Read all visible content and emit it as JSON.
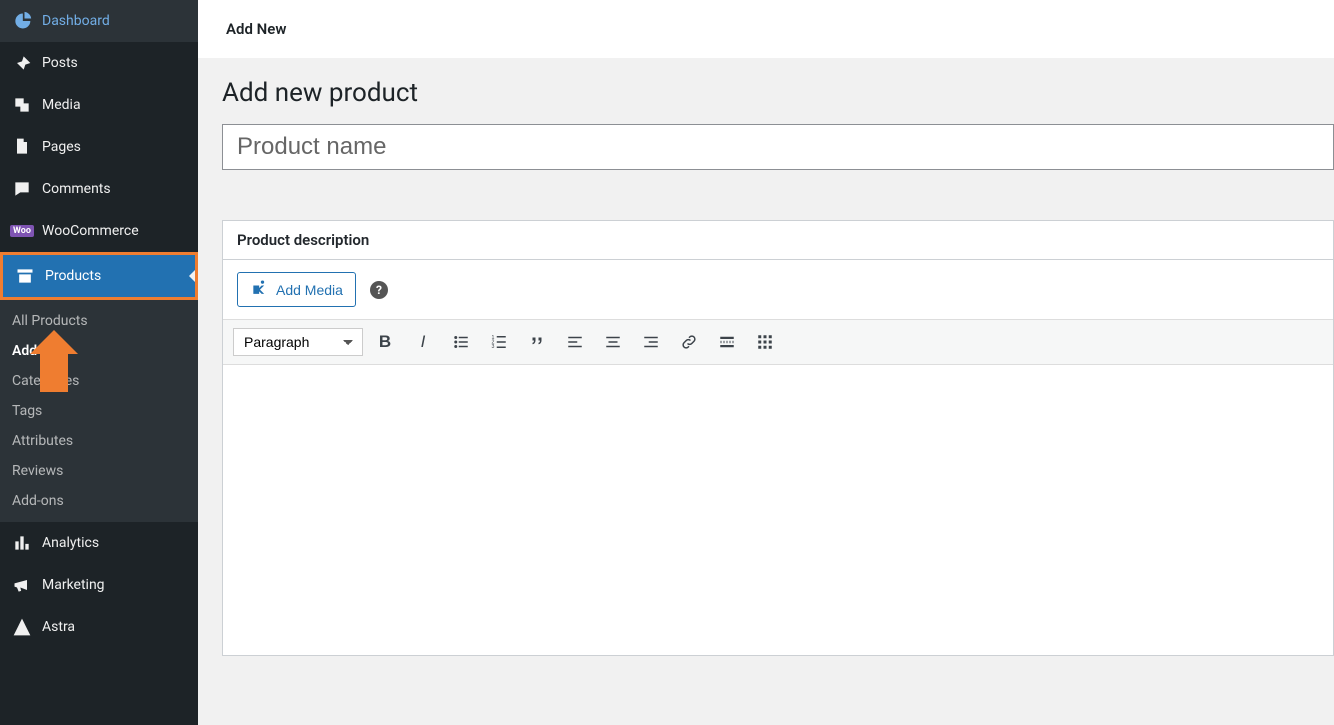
{
  "sidebar": {
    "items": [
      {
        "label": "Dashboard"
      },
      {
        "label": "Posts"
      },
      {
        "label": "Media"
      },
      {
        "label": "Pages"
      },
      {
        "label": "Comments"
      },
      {
        "label": "WooCommerce"
      },
      {
        "label": "Products"
      },
      {
        "label": "Analytics"
      },
      {
        "label": "Marketing"
      },
      {
        "label": "Astra"
      }
    ],
    "submenu": [
      {
        "label": "All Products"
      },
      {
        "label": "Add New"
      },
      {
        "label": "Categories"
      },
      {
        "label": "Tags"
      },
      {
        "label": "Attributes"
      },
      {
        "label": "Reviews"
      },
      {
        "label": "Add-ons"
      }
    ]
  },
  "header": {
    "breadcrumb": "Add New"
  },
  "page": {
    "title": "Add new product",
    "name_placeholder": "Product name",
    "desc_label": "Product description",
    "add_media_label": "Add Media",
    "format_label": "Paragraph"
  }
}
